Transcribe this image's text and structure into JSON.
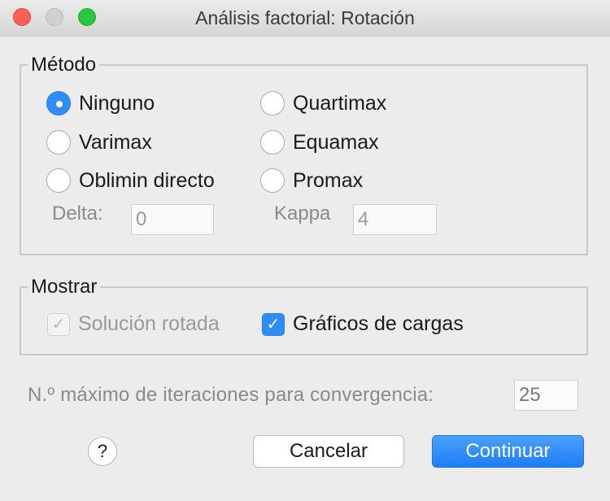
{
  "window": {
    "title": "Análisis factorial: Rotación"
  },
  "metodo": {
    "legend": "Método",
    "options": [
      {
        "label": "Ninguno",
        "selected": true
      },
      {
        "label": "Quartimax",
        "selected": false
      },
      {
        "label": "Varimax",
        "selected": false
      },
      {
        "label": "Equamax",
        "selected": false
      },
      {
        "label": "Oblimin directo",
        "selected": false
      },
      {
        "label": "Promax",
        "selected": false
      }
    ],
    "delta": {
      "label": "Delta:",
      "value": "0"
    },
    "kappa": {
      "label": "Kappa",
      "value": "4"
    }
  },
  "mostrar": {
    "legend": "Mostrar",
    "solucion_rotada": {
      "label": "Solución rotada",
      "checked": true,
      "enabled": false
    },
    "graficos_cargas": {
      "label": "Gráficos de cargas",
      "checked": true,
      "enabled": true
    }
  },
  "iteraciones": {
    "label": "N.º máximo de iteraciones para convergencia:",
    "value": "25"
  },
  "buttons": {
    "help": "?",
    "cancel": "Cancelar",
    "continue": "Continuar"
  },
  "colors": {
    "accent": "#2f8df8",
    "close": "#fe5f57",
    "maximize": "#2ac840"
  }
}
